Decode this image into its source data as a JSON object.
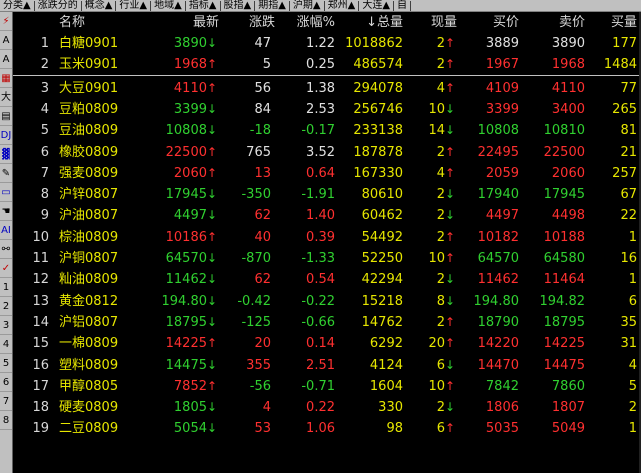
{
  "tabs": [
    "分类▲",
    "涨跌分的",
    "概念▲",
    "行业▲",
    "地域▲",
    "指标▲",
    "股指▲",
    "期指▲",
    "沪期▲",
    "郑州▲",
    "大连▲",
    "自"
  ],
  "left_tools": [
    {
      "icon": "lightning-icon",
      "glyph": "⚡",
      "tone": "red"
    },
    {
      "icon": "font-increase-icon",
      "glyph": "A",
      "tone": ""
    },
    {
      "icon": "font-decrease-icon",
      "glyph": "A",
      "tone": ""
    },
    {
      "icon": "grid-icon",
      "glyph": "▦",
      "tone": "red"
    },
    {
      "icon": "big-char-icon",
      "glyph": "大",
      "tone": ""
    },
    {
      "icon": "calendar-icon",
      "glyph": "▤",
      "tone": ""
    },
    {
      "icon": "dj-icon",
      "glyph": "DJ",
      "tone": "blue"
    },
    {
      "icon": "chart-icon",
      "glyph": "▓",
      "tone": "blue"
    },
    {
      "icon": "pen-icon",
      "glyph": "✎",
      "tone": ""
    },
    {
      "icon": "line-chart-icon",
      "glyph": "▭",
      "tone": "blue"
    },
    {
      "icon": "hand-icon",
      "glyph": "☚",
      "tone": ""
    },
    {
      "icon": "ai-icon",
      "glyph": "AI",
      "tone": "blue"
    },
    {
      "icon": "link-icon",
      "glyph": "⚯",
      "tone": ""
    },
    {
      "icon": "check-icon",
      "glyph": "✓",
      "tone": "red"
    },
    {
      "icon": "one-icon",
      "glyph": "1",
      "tone": ""
    },
    {
      "icon": "two-icon",
      "glyph": "2",
      "tone": ""
    },
    {
      "icon": "three-icon",
      "glyph": "3",
      "tone": ""
    },
    {
      "icon": "four-icon",
      "glyph": "4",
      "tone": ""
    },
    {
      "icon": "five-icon",
      "glyph": "5",
      "tone": ""
    },
    {
      "icon": "six-icon",
      "glyph": "6",
      "tone": ""
    },
    {
      "icon": "seven-icon",
      "glyph": "7",
      "tone": ""
    },
    {
      "icon": "eight-icon",
      "glyph": "8",
      "tone": ""
    }
  ],
  "header": {
    "name": "名称",
    "latest": "最新",
    "chg": "涨跌",
    "pct": "涨幅%",
    "vol": "↓总量",
    "cur": "现量",
    "bid": "买价",
    "ask": "卖价",
    "bv": "买量"
  },
  "rows": [
    {
      "idx": "1",
      "name": "白糖0901",
      "latest": "3890",
      "dir": "dn",
      "chg": "47",
      "chg_dir": "eq",
      "pct": "1.22",
      "pct_dir": "eq",
      "vol": "1018862",
      "cur": "2",
      "cur_dir": "up",
      "bid": "3889",
      "bid_dir": "eq",
      "ask": "3890",
      "ask_dir": "eq",
      "bv": "177"
    },
    {
      "idx": "2",
      "name": "玉米0901",
      "latest": "1968",
      "dir": "up",
      "chg": "5",
      "chg_dir": "eq",
      "pct": "0.25",
      "pct_dir": "eq",
      "vol": "486574",
      "cur": "2",
      "cur_dir": "up",
      "bid": "1967",
      "bid_dir": "up",
      "ask": "1968",
      "ask_dir": "up",
      "bv": "1484"
    },
    {
      "idx": "3",
      "name": "大豆0901",
      "latest": "4110",
      "dir": "up",
      "chg": "56",
      "chg_dir": "eq",
      "pct": "1.38",
      "pct_dir": "eq",
      "vol": "294078",
      "cur": "4",
      "cur_dir": "up",
      "bid": "4109",
      "bid_dir": "up",
      "ask": "4110",
      "ask_dir": "up",
      "bv": "77"
    },
    {
      "idx": "4",
      "name": "豆粕0809",
      "latest": "3399",
      "dir": "dn",
      "chg": "84",
      "chg_dir": "eq",
      "pct": "2.53",
      "pct_dir": "eq",
      "vol": "256746",
      "cur": "10",
      "cur_dir": "dn",
      "bid": "3399",
      "bid_dir": "up",
      "ask": "3400",
      "ask_dir": "up",
      "bv": "265"
    },
    {
      "idx": "5",
      "name": "豆油0809",
      "latest": "10808",
      "dir": "dn",
      "chg": "-18",
      "chg_dir": "dn",
      "pct": "-0.17",
      "pct_dir": "dn",
      "vol": "233138",
      "cur": "14",
      "cur_dir": "dn",
      "bid": "10808",
      "bid_dir": "dn",
      "ask": "10810",
      "ask_dir": "dn",
      "bv": "81"
    },
    {
      "idx": "6",
      "name": "橡胶0809",
      "latest": "22500",
      "dir": "up",
      "chg": "765",
      "chg_dir": "eq",
      "pct": "3.52",
      "pct_dir": "eq",
      "vol": "187878",
      "cur": "2",
      "cur_dir": "up",
      "bid": "22495",
      "bid_dir": "up",
      "ask": "22500",
      "ask_dir": "up",
      "bv": "21"
    },
    {
      "idx": "7",
      "name": "强麦0809",
      "latest": "2060",
      "dir": "up",
      "chg": "13",
      "chg_dir": "up",
      "pct": "0.64",
      "pct_dir": "up",
      "vol": "167330",
      "cur": "4",
      "cur_dir": "up",
      "bid": "2059",
      "bid_dir": "up",
      "ask": "2060",
      "ask_dir": "up",
      "bv": "257"
    },
    {
      "idx": "8",
      "name": "沪锌0807",
      "latest": "17945",
      "dir": "dn",
      "chg": "-350",
      "chg_dir": "dn",
      "pct": "-1.91",
      "pct_dir": "dn",
      "vol": "80610",
      "cur": "2",
      "cur_dir": "dn",
      "bid": "17940",
      "bid_dir": "dn",
      "ask": "17945",
      "ask_dir": "dn",
      "bv": "67"
    },
    {
      "idx": "9",
      "name": "沪油0807",
      "latest": "4497",
      "dir": "dn",
      "chg": "62",
      "chg_dir": "up",
      "pct": "1.40",
      "pct_dir": "up",
      "vol": "60462",
      "cur": "2",
      "cur_dir": "dn",
      "bid": "4497",
      "bid_dir": "up",
      "ask": "4498",
      "ask_dir": "up",
      "bv": "22"
    },
    {
      "idx": "10",
      "name": "棕油0809",
      "latest": "10186",
      "dir": "up",
      "chg": "40",
      "chg_dir": "up",
      "pct": "0.39",
      "pct_dir": "up",
      "vol": "54492",
      "cur": "2",
      "cur_dir": "up",
      "bid": "10182",
      "bid_dir": "up",
      "ask": "10188",
      "ask_dir": "up",
      "bv": "1"
    },
    {
      "idx": "11",
      "name": "沪铜0807",
      "latest": "64570",
      "dir": "dn",
      "chg": "-870",
      "chg_dir": "dn",
      "pct": "-1.33",
      "pct_dir": "dn",
      "vol": "52250",
      "cur": "10",
      "cur_dir": "up",
      "bid": "64570",
      "bid_dir": "dn",
      "ask": "64580",
      "ask_dir": "dn",
      "bv": "16"
    },
    {
      "idx": "12",
      "name": "籼油0809",
      "latest": "11462",
      "dir": "dn",
      "chg": "62",
      "chg_dir": "up",
      "pct": "0.54",
      "pct_dir": "up",
      "vol": "42294",
      "cur": "2",
      "cur_dir": "dn",
      "bid": "11462",
      "bid_dir": "up",
      "ask": "11464",
      "ask_dir": "up",
      "bv": "1"
    },
    {
      "idx": "13",
      "name": "黄金0812",
      "latest": "194.80",
      "dir": "dn",
      "chg": "-0.42",
      "chg_dir": "dn",
      "pct": "-0.22",
      "pct_dir": "dn",
      "vol": "15218",
      "cur": "8",
      "cur_dir": "dn",
      "bid": "194.80",
      "bid_dir": "dn",
      "ask": "194.82",
      "ask_dir": "dn",
      "bv": "6"
    },
    {
      "idx": "14",
      "name": "沪铝0807",
      "latest": "18795",
      "dir": "dn",
      "chg": "-125",
      "chg_dir": "dn",
      "pct": "-0.66",
      "pct_dir": "dn",
      "vol": "14762",
      "cur": "2",
      "cur_dir": "up",
      "bid": "18790",
      "bid_dir": "dn",
      "ask": "18795",
      "ask_dir": "dn",
      "bv": "35"
    },
    {
      "idx": "15",
      "name": "一棉0809",
      "latest": "14225",
      "dir": "up",
      "chg": "20",
      "chg_dir": "up",
      "pct": "0.14",
      "pct_dir": "up",
      "vol": "6292",
      "cur": "20",
      "cur_dir": "up",
      "bid": "14220",
      "bid_dir": "up",
      "ask": "14225",
      "ask_dir": "up",
      "bv": "31"
    },
    {
      "idx": "16",
      "name": "塑料0809",
      "latest": "14475",
      "dir": "dn",
      "chg": "355",
      "chg_dir": "up",
      "pct": "2.51",
      "pct_dir": "up",
      "vol": "4124",
      "cur": "6",
      "cur_dir": "dn",
      "bid": "14470",
      "bid_dir": "up",
      "ask": "14475",
      "ask_dir": "up",
      "bv": "4"
    },
    {
      "idx": "17",
      "name": "甲醇0805",
      "latest": "7852",
      "dir": "up",
      "chg": "-56",
      "chg_dir": "dn",
      "pct": "-0.71",
      "pct_dir": "dn",
      "vol": "1604",
      "cur": "10",
      "cur_dir": "up",
      "bid": "7842",
      "bid_dir": "dn",
      "ask": "7860",
      "ask_dir": "dn",
      "bv": "5"
    },
    {
      "idx": "18",
      "name": "硬麦0809",
      "latest": "1805",
      "dir": "dn",
      "chg": "4",
      "chg_dir": "up",
      "pct": "0.22",
      "pct_dir": "up",
      "vol": "330",
      "cur": "2",
      "cur_dir": "dn",
      "bid": "1806",
      "bid_dir": "up",
      "ask": "1807",
      "ask_dir": "up",
      "bv": "2"
    },
    {
      "idx": "19",
      "name": "二豆0809",
      "latest": "5054",
      "dir": "dn",
      "chg": "53",
      "chg_dir": "up",
      "pct": "1.06",
      "pct_dir": "up",
      "vol": "98",
      "cur": "6",
      "cur_dir": "up",
      "bid": "5035",
      "bid_dir": "up",
      "ask": "5049",
      "ask_dir": "up",
      "bv": "1"
    }
  ]
}
